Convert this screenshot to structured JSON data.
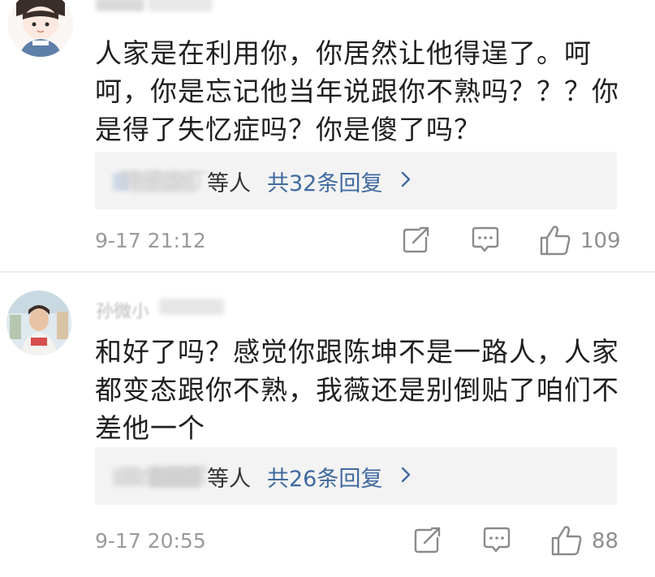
{
  "comments": [
    {
      "text": "人家是在利用你，你居然让他得逞了。呵呵，你是忘记他当年说跟你不熟吗？？？你是得了失忆症吗？你是傻了吗？",
      "replies": {
        "names_blurred": "胖子少丁",
        "suffix": "等人",
        "count_link": "共32条回复"
      },
      "time": "9-17 21:12",
      "likes": "109",
      "colors": {
        "link": "#3f6aa0",
        "meta": "#9a9a9a"
      }
    },
    {
      "username_fragment": "孙微小",
      "text": "和好了吗？感觉你跟陈坤不是一路人，人家都变态跟你不熟，我薇还是别倒贴了咱们不差他一个",
      "replies": {
        "names_blurred": "三分三常",
        "suffix": "等人",
        "count_link": "共26条回复"
      },
      "time": "9-17 20:55",
      "likes": "88",
      "colors": {
        "link": "#3f6aa0",
        "meta": "#9a9a9a"
      }
    }
  ],
  "icons": {
    "share": "share-icon",
    "reply": "comment-icon",
    "like": "thumbs-up-icon",
    "chevron": "chevron-right-icon"
  }
}
